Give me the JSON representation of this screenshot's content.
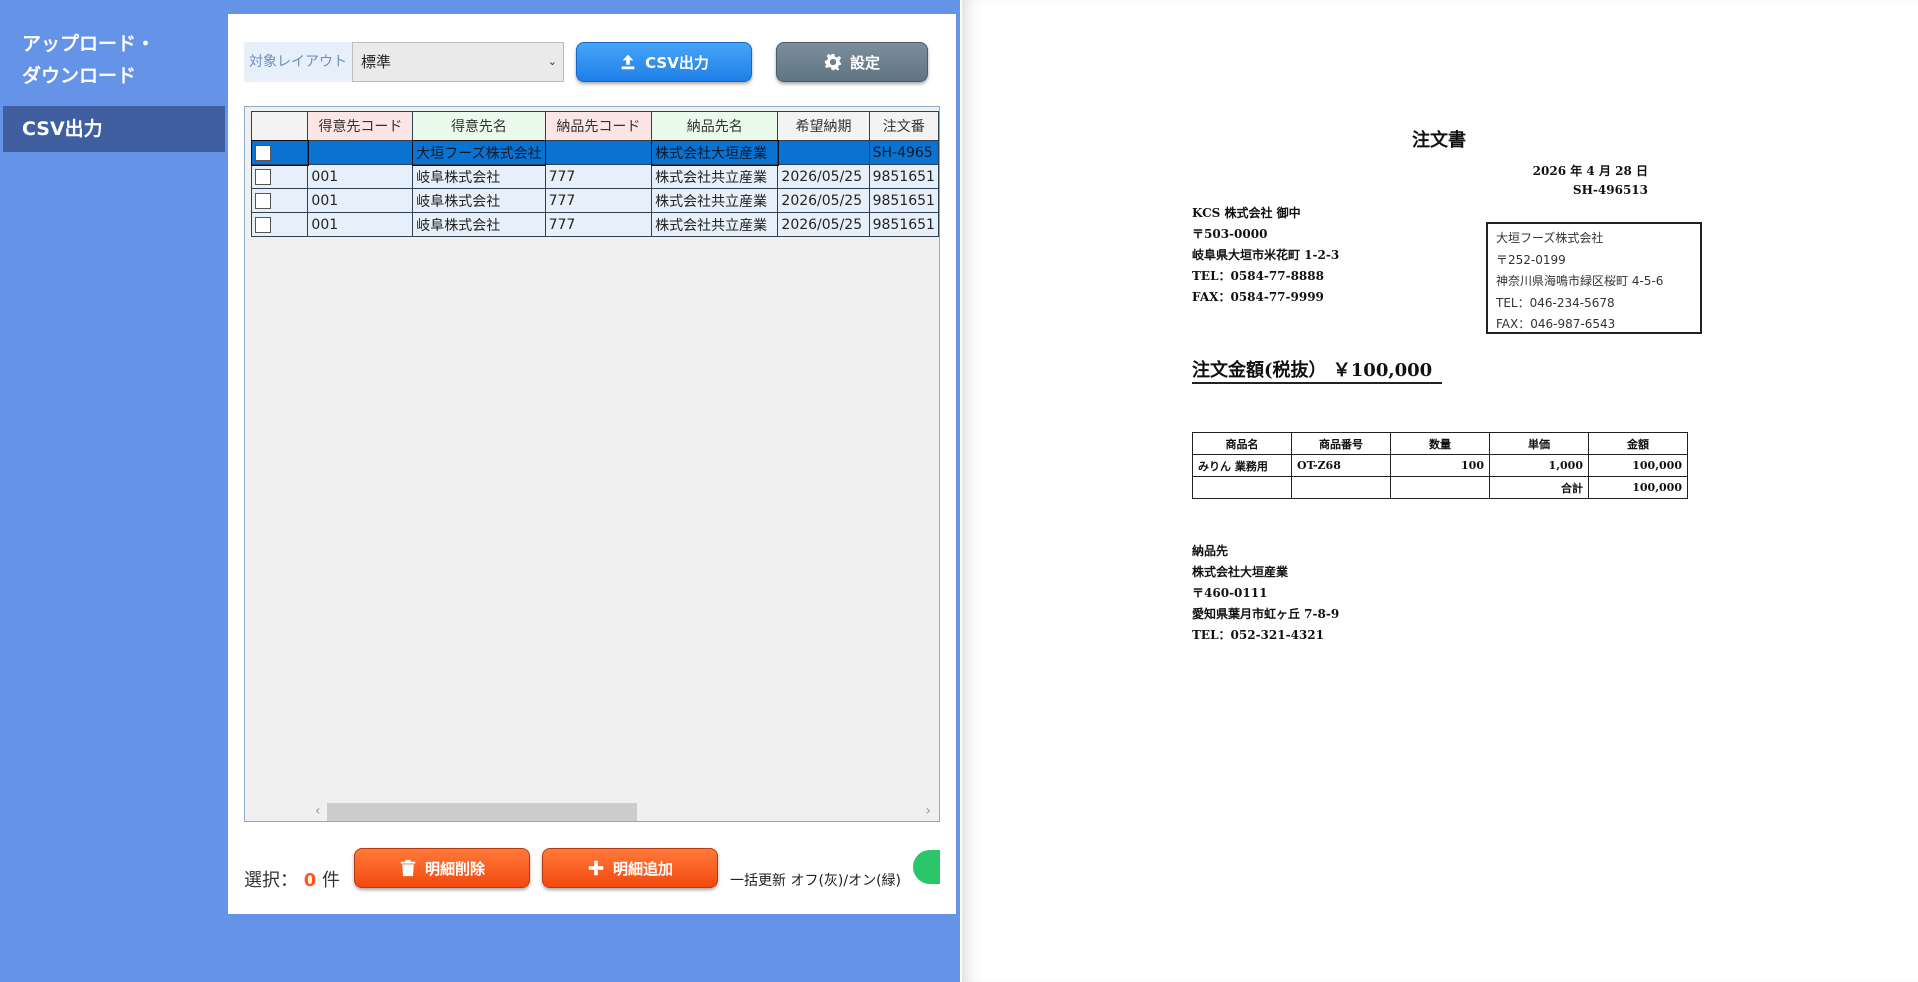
{
  "sidebar": {
    "items": [
      {
        "label": "アップロード・ダウンロード",
        "line1": "アップロード・",
        "line2": "ダウンロード"
      },
      {
        "label": "CSV出力"
      }
    ]
  },
  "toolbar": {
    "layout_label": "対象レイアウト",
    "layout_value": "標準",
    "csv_label": "CSV出力",
    "settings_label": "設定"
  },
  "grid": {
    "columns": [
      "得意先コード",
      "得意先名",
      "納品先コード",
      "納品先名",
      "希望納期",
      "注文番"
    ],
    "rows": [
      {
        "code": "",
        "name": "大垣フーズ株式会社",
        "dcode": "",
        "dname": "株式会社大垣産業",
        "date": "",
        "order": "SH-4965"
      },
      {
        "code": "001",
        "name": "岐阜株式会社",
        "dcode": "777",
        "dname": "株式会社共立産業",
        "date": "2026/05/25",
        "order": "9851651"
      },
      {
        "code": "001",
        "name": "岐阜株式会社",
        "dcode": "777",
        "dname": "株式会社共立産業",
        "date": "2026/05/25",
        "order": "9851651"
      },
      {
        "code": "001",
        "name": "岐阜株式会社",
        "dcode": "777",
        "dname": "株式会社共立産業",
        "date": "2026/05/25",
        "order": "9851651"
      }
    ]
  },
  "footer": {
    "selection_prefix": "選択：",
    "selection_count": "0",
    "selection_suffix": "件",
    "delete_label": "明細削除",
    "add_label": "明細追加",
    "bulk_label": "一括更新 オフ(灰)/オン(緑)"
  },
  "document": {
    "title": "注文書",
    "date": "2026 年 4 月 28 日",
    "number": "SH-496513",
    "buyer": {
      "name": "KCS 株式会社 御中",
      "postal": "〒503-0000",
      "address": "岐阜県大垣市米花町 1-2-3",
      "tel": "TEL：0584-77-8888",
      "fax": "FAX：0584-77-9999"
    },
    "vendor": {
      "name": "大垣フーズ株式会社",
      "postal": "〒252-0199",
      "address": "神奈川県海鳴市緑区桜町  4-5-6",
      "tel": "TEL：046-234-5678",
      "fax": "FAX：046-987-6543"
    },
    "amount": "注文金額(税抜）  ￥100,000",
    "items_headers": [
      "商品名",
      "商品番号",
      "数量",
      "単価",
      "金額"
    ],
    "items": [
      {
        "name": "みりん  業務用",
        "code": "OT-Z68",
        "qty": "100",
        "price": "1,000",
        "amount": "100,000"
      }
    ],
    "total_label": "合計",
    "total_value": "100,000",
    "delivery": {
      "heading": "納品先",
      "name": "株式会社大垣産業",
      "postal": "〒460-0111",
      "address": "愛知県葉月市虹ヶ丘  7-8-9",
      "tel": "TEL：052-321-4321"
    }
  },
  "colors": {
    "app_background": "#6593E8",
    "sidebar_active": "#3F5FA0",
    "primary_button": "#1F7EE8",
    "danger_button": "#F4480E",
    "selected_row": "#0A72D1",
    "toggle_on": "#2BC56A"
  }
}
